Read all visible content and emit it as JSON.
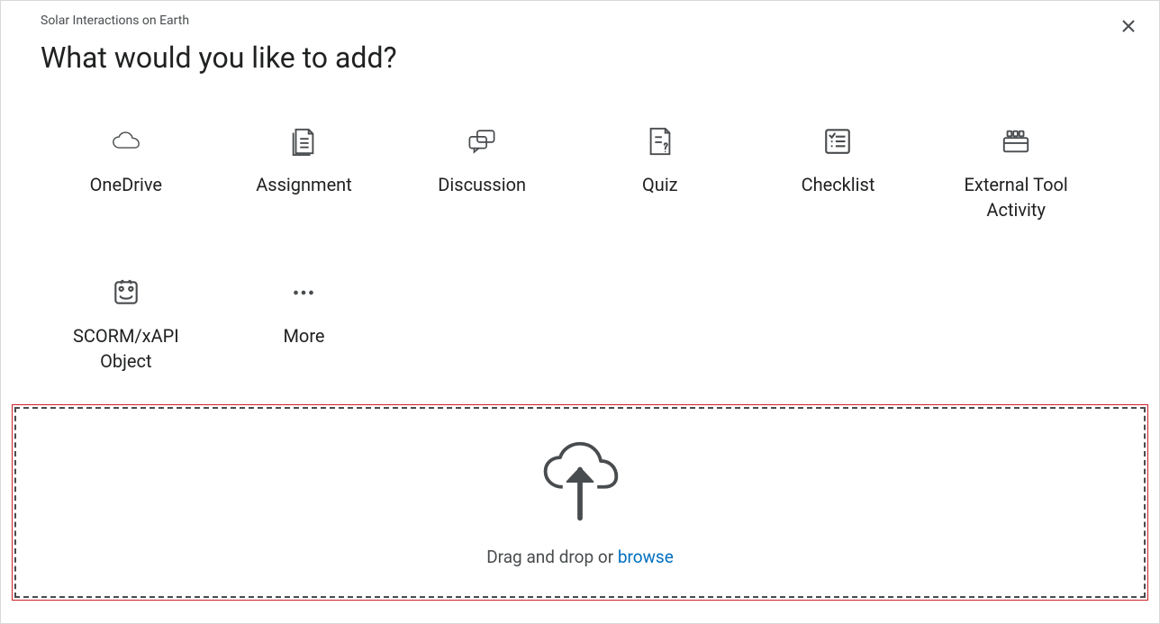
{
  "header": {
    "module_name": "Solar Interactions on Earth",
    "title": "What would you like to add?"
  },
  "tiles": [
    {
      "label": "OneDrive",
      "icon": "cloud-icon"
    },
    {
      "label": "Assignment",
      "icon": "assignment-icon"
    },
    {
      "label": "Discussion",
      "icon": "discussion-icon"
    },
    {
      "label": "Quiz",
      "icon": "quiz-icon"
    },
    {
      "label": "Checklist",
      "icon": "checklist-icon"
    },
    {
      "label": "External Tool Activity",
      "icon": "external-tool-icon"
    },
    {
      "label": "SCORM/xAPI Object",
      "icon": "scorm-icon"
    },
    {
      "label": "More",
      "icon": "more-icon"
    }
  ],
  "dropzone": {
    "text_prefix": "Drag and drop or ",
    "link_text": "browse"
  }
}
